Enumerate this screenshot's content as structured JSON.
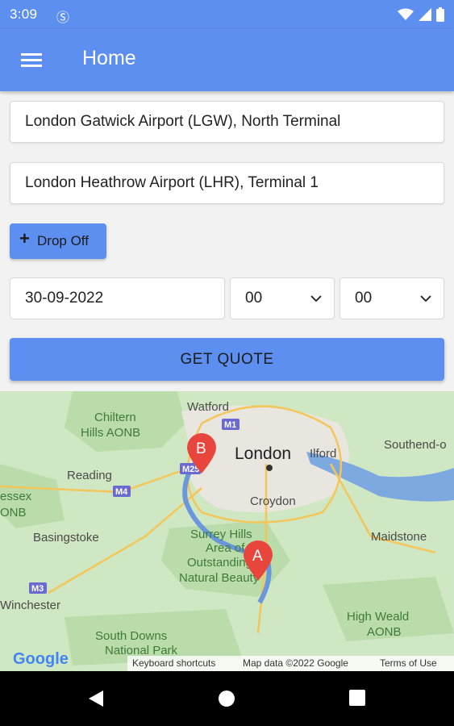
{
  "status": {
    "time": "3:09",
    "extra_icon": "sim-icon"
  },
  "app_bar": {
    "title": "Home",
    "menu_icon": "hamburger-menu-icon"
  },
  "form": {
    "pickup": "London Gatwick Airport (LGW), North Terminal",
    "destination": "London Heathrow Airport (LHR), Terminal 1",
    "dropoff_label": "Drop Off",
    "date": "30-09-2022",
    "hour": "00",
    "minute": "00",
    "quote_label": "GET QUOTE"
  },
  "map": {
    "places": {
      "watford": "Watford",
      "chiltern": "Chiltern",
      "hills_aonb": "Hills AONB",
      "london": "London",
      "ilford": "Ilford",
      "southend": "Southend-o",
      "reading": "Reading",
      "essex": "essex",
      "onb": "ONB",
      "croydon": "Croydon",
      "basingstoke": "Basingstoke",
      "maidstone": "Maidstone",
      "surrey1": "Surrey Hills",
      "surrey2": "Area of",
      "surrey3": "Outstanding",
      "surrey4": "Natural Beauty",
      "winchester": "Winchester",
      "high_weald": "High Weald",
      "aonb": "AONB",
      "south_downs": "South Downs",
      "national_park": "National Park"
    },
    "roads": {
      "m1": "M1",
      "m25": "M25",
      "m4": "M4",
      "m3": "M3"
    },
    "markers": {
      "a": "A",
      "b": "B"
    },
    "google": "Google",
    "footer": {
      "shortcuts": "Keyboard shortcuts",
      "data": "Map data ©2022 Google",
      "terms": "Terms of Use"
    },
    "colors": {
      "land": "#cfe8c3",
      "urban": "#ebe9e4",
      "water": "#7ea9e0",
      "route": "#5f8fe0",
      "marker": "#e8453c"
    }
  },
  "nav": {
    "back": "back-icon",
    "home": "home-icon",
    "recents": "recents-icon"
  }
}
